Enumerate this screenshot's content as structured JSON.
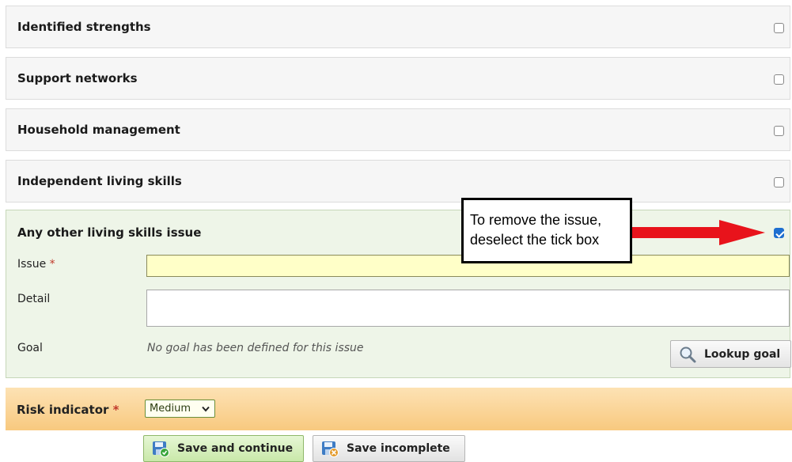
{
  "sections": [
    {
      "title": "Identified strengths",
      "checked": false
    },
    {
      "title": "Support networks",
      "checked": false
    },
    {
      "title": "Household management",
      "checked": false
    },
    {
      "title": "Independent living skills",
      "checked": false
    }
  ],
  "expanded_section": {
    "title": "Any other living skills issue",
    "checked": true,
    "issue_label": "Issue",
    "required_marker": "*",
    "issue_value": "",
    "detail_label": "Detail",
    "detail_value": "",
    "goal_label": "Goal",
    "goal_note": "No goal has been defined for this issue",
    "lookup_goal_label": "Lookup goal"
  },
  "callout": {
    "line1": "To remove the issue,",
    "line2": "deselect the tick box",
    "arrow_color": "#e8131b"
  },
  "risk": {
    "label": "Risk indicator",
    "required_marker": "*",
    "selected": "Medium"
  },
  "actions": {
    "save_continue_label": "Save and continue",
    "save_incomplete_label": "Save incomplete"
  },
  "colors": {
    "section_bg": "#f6f6f6",
    "expanded_bg": "#eef5e8",
    "issue_field_bg": "#ffffc8",
    "risk_bar": "#f9cd86",
    "primary_button": "#d9f0c2",
    "checkbox_on": "#1e6fd0"
  }
}
